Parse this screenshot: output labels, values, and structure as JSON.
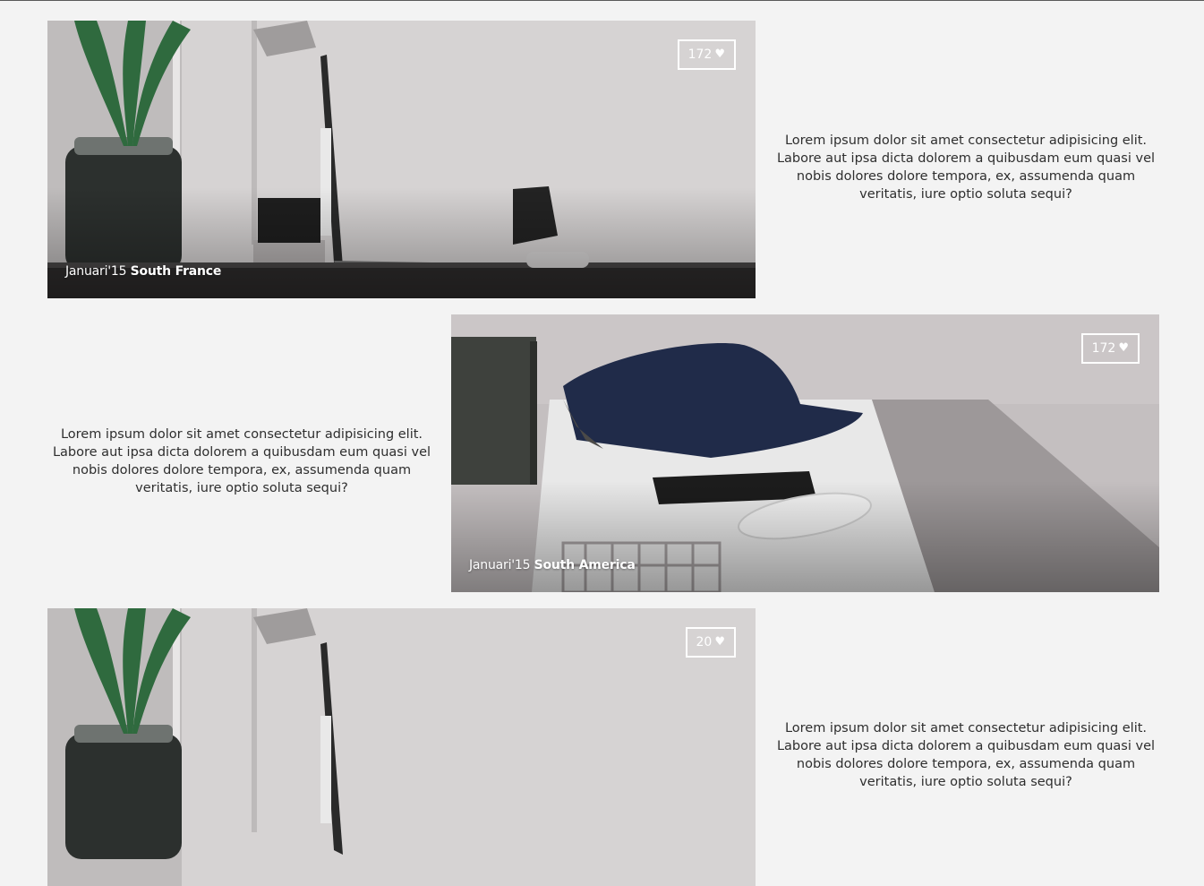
{
  "posts": [
    {
      "likes": "172",
      "heart": "♥",
      "date": "Januari'15",
      "place": "South France",
      "text": "Lorem ipsum dolor sit amet consectetur adipisicing elit. Labore aut ipsa dicta dolorem a quibusdam eum quasi vel nobis dolores dolore tempora, ex, assumenda quam veritatis, iure optio soluta sequi?"
    },
    {
      "likes": "172",
      "heart": "♥",
      "date": "Januari'15",
      "place": "South America",
      "text": "Lorem ipsum dolor sit amet consectetur adipisicing elit. Labore aut ipsa dicta dolorem a quibusdam eum quasi vel nobis dolores dolore tempora, ex, assumenda quam veritatis, iure optio soluta sequi?"
    },
    {
      "likes": "20",
      "heart": "♥",
      "text": "Lorem ipsum dolor sit amet consectetur adipisicing elit. Labore aut ipsa dicta dolorem a quibusdam eum quasi vel nobis dolores dolore tempora, ex, assumenda quam veritatis, iure optio soluta sequi?"
    }
  ]
}
